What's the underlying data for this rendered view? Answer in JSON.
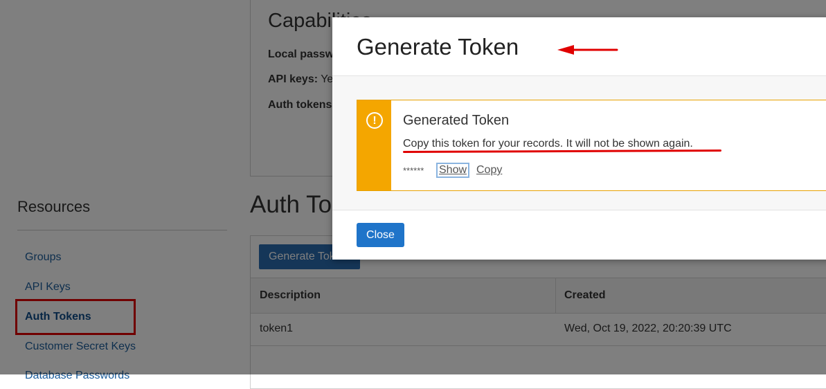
{
  "capabilities": {
    "title": "Capabilities",
    "rows": [
      {
        "label": "Local password",
        "value": ""
      },
      {
        "label": "API keys:",
        "value": "Yes"
      },
      {
        "label": "Auth tokens",
        "value": ""
      }
    ]
  },
  "resources": {
    "title": "Resources",
    "items": [
      {
        "label": "Groups"
      },
      {
        "label": "API Keys"
      },
      {
        "label": "Auth Tokens",
        "active": true
      },
      {
        "label": "Customer Secret Keys"
      },
      {
        "label": "Database Passwords"
      }
    ]
  },
  "auth_tokens": {
    "heading": "Auth Tokens",
    "generate_button": "Generate Token",
    "table": {
      "columns": [
        "Description",
        "Created"
      ],
      "rows": [
        {
          "description": "token1",
          "created": "Wed, Oct 19, 2022, 20:20:39 UTC"
        }
      ]
    }
  },
  "modal": {
    "title": "Generate Token",
    "alert": {
      "icon": "exclamation-circle-icon",
      "title": "Generated Token",
      "message": "Copy this token for your records. It will not be shown again.",
      "token_masked": "******",
      "show_label": "Show",
      "copy_label": "Copy"
    },
    "close_label": "Close"
  },
  "colors": {
    "accent": "#1f74c9",
    "alert_strip": "#f4a600",
    "annotation_red": "#e00000"
  }
}
